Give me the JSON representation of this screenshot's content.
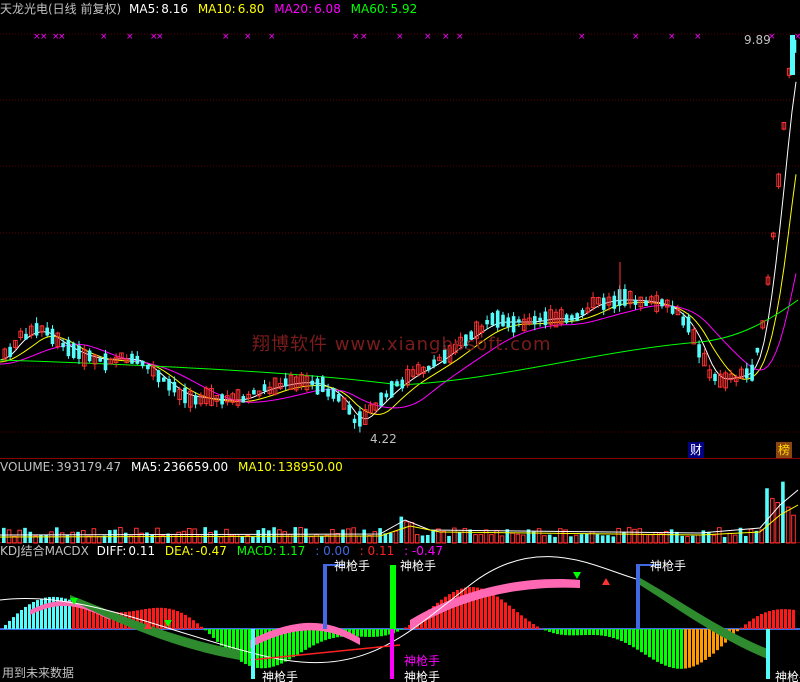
{
  "main_header": {
    "stock_title": "天龙光电(日线 前复权)",
    "ma5_label": "MA5:",
    "ma5_value": "8.16",
    "ma10_label": "MA10:",
    "ma10_value": "6.80",
    "ma20_label": "MA20:",
    "ma20_value": "6.08",
    "ma60_label": "MA60:",
    "ma60_value": "5.92"
  },
  "main_chart": {
    "high_label": "9.89",
    "low_label": "4.22",
    "watermark": "翔博软件  www.xiangbosoft.com",
    "badge_cai": "财",
    "badge_bang": "榜"
  },
  "volume_header": {
    "volume_label": "VOLUME:",
    "volume_value": "393179.47",
    "ma5_label": "MA5:",
    "ma5_value": "236659.00",
    "ma10_label": "MA10:",
    "ma10_value": "138950.00"
  },
  "indicator_header": {
    "name": "KDJ结合MACDX",
    "diff_label": "DIFF:",
    "diff_value": "0.11",
    "dea_label": "DEA:",
    "dea_value": "-0.47",
    "macd_label": "MACD:",
    "macd_value": "1.17",
    "extra1": ": 0.00",
    "extra2": ": 0.11",
    "extra3": ": -0.47"
  },
  "indicator_chart": {
    "sqs_label": "神枪手",
    "future_note": "用到未来数据"
  },
  "colors": {
    "up": "#ff3232",
    "down": "#54fcfc",
    "ma5": "#ffffff",
    "ma10": "#ffff00",
    "ma20": "#ff00ff",
    "ma60": "#00ff00"
  }
}
